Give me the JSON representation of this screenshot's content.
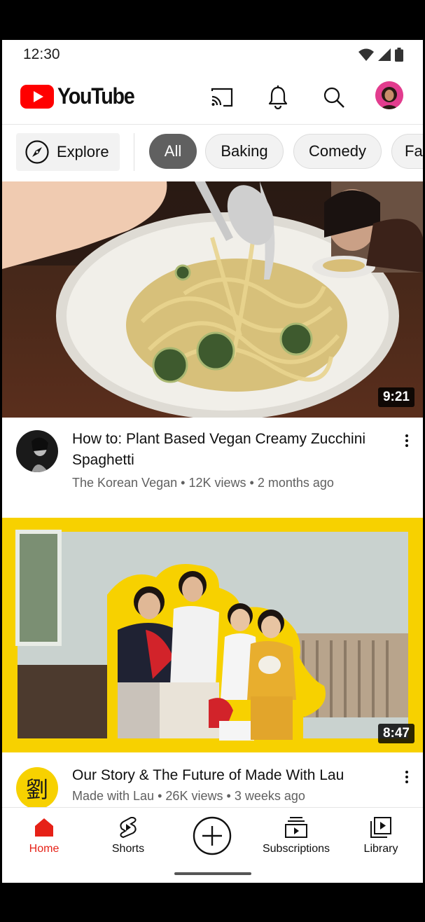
{
  "status_bar": {
    "time": "12:30"
  },
  "app_bar": {
    "logo_text": "YouTube"
  },
  "chips": {
    "explore": "Explore",
    "items": [
      "All",
      "Baking",
      "Comedy",
      "Fa"
    ]
  },
  "videos": [
    {
      "duration": "9:21",
      "title": "How to: Plant Based Vegan Creamy Zucchini Spaghetti",
      "channel": "The Korean Vegan",
      "views": "12K views",
      "age": "2 months ago"
    },
    {
      "duration": "8:47",
      "title": "Our Story & The Future of Made With Lau",
      "channel": "Made with Lau",
      "views": "26K views",
      "age": "3 weeks ago",
      "channel_logo_char": "劉"
    }
  ],
  "separator": "•",
  "bottom_nav": {
    "home": "Home",
    "shorts": "Shorts",
    "subscriptions": "Subscriptions",
    "library": "Library"
  },
  "colors": {
    "brand_red": "#ff0000",
    "accent_yellow": "#f7d100",
    "chip_active": "#606060"
  }
}
